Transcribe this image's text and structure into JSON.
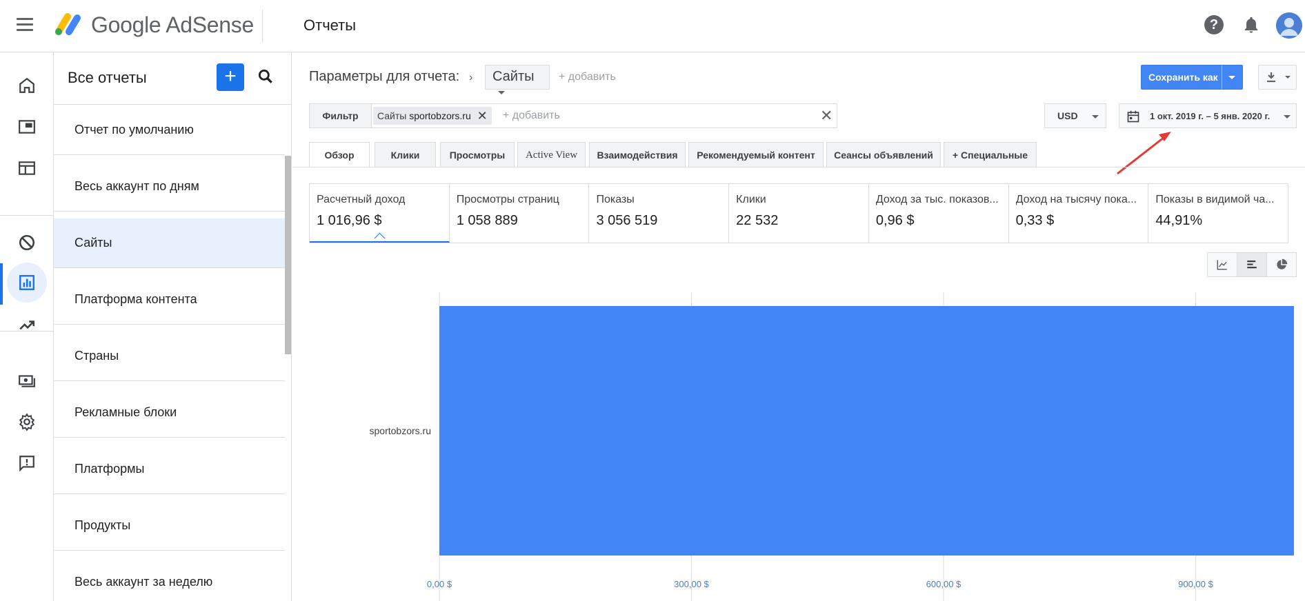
{
  "header": {
    "app_name": "Google AdSense",
    "page_title": "Отчеты"
  },
  "rail": {
    "items": [
      "home-icon",
      "ad-units-icon",
      "layout-icon",
      "block-icon",
      "reports-icon",
      "trending-icon",
      "payments-icon",
      "settings-icon",
      "feedback-icon"
    ],
    "active": "reports-icon"
  },
  "sidebar": {
    "title": "Все отчеты",
    "items": [
      {
        "label": "Отчет по умолчанию"
      },
      {
        "label": "Весь аккаунт по дням"
      },
      {
        "label": "Сайты"
      },
      {
        "label": "Платформа контента"
      },
      {
        "label": "Страны"
      },
      {
        "label": "Рекламные блоки"
      },
      {
        "label": "Платформы"
      },
      {
        "label": "Продукты"
      },
      {
        "label": "Весь аккаунт за неделю"
      }
    ],
    "selected": "Сайты"
  },
  "params": {
    "label": "Параметры для отчета:",
    "dimension": "Сайты",
    "add": "+ добавить"
  },
  "toolbar": {
    "save_label": "Сохранить как"
  },
  "filter": {
    "label": "Фильтр",
    "chip_prefix": "Сайты",
    "chip_value": "sportobzors.ru",
    "add": "+ добавить"
  },
  "currency": "USD",
  "date_range": "1 окт. 2019 г. – 5 янв. 2020 г.",
  "tabs": [
    {
      "label": "Обзор"
    },
    {
      "label": "Клики"
    },
    {
      "label": "Просмотры"
    },
    {
      "label": "Active View"
    },
    {
      "label": "Взаимодействия"
    },
    {
      "label": "Рекомендуемый контент"
    },
    {
      "label": "Сеансы объявлений"
    },
    {
      "label": "Специальные"
    }
  ],
  "metrics": [
    {
      "label": "Расчетный доход",
      "value": "1 016,96 $"
    },
    {
      "label": "Просмотры страниц",
      "value": "1 058 889"
    },
    {
      "label": "Показы",
      "value": "3 056 519"
    },
    {
      "label": "Клики",
      "value": "22 532"
    },
    {
      "label": "Доход за тыс. показов...",
      "value": "0,96 $"
    },
    {
      "label": "Доход на тысячу пока...",
      "value": "0,33 $"
    },
    {
      "label": "Показы в видимой ча...",
      "value": "44,91%"
    }
  ],
  "colors": {
    "accent": "#1a73e8",
    "bar": "#4285f4",
    "axis_label": "#4a7fc4"
  },
  "chart_data": {
    "type": "bar",
    "orientation": "horizontal",
    "categories": [
      "sportobzors.ru"
    ],
    "values": [
      1016.96
    ],
    "xlim": [
      0,
      1040
    ],
    "xticks": [
      0,
      300,
      600,
      900
    ],
    "xtick_labels": [
      "0,00 $",
      "300,00 $",
      "600,00 $",
      "900,00 $"
    ],
    "grid": true
  }
}
